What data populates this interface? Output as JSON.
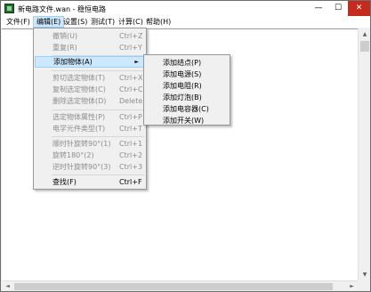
{
  "window": {
    "title": "新电路文件.wan - 稳恒电路",
    "minimize_glyph": "—",
    "maximize_glyph": "☐",
    "close_glyph": "✕",
    "close_color": "#c42b1c",
    "icon": "circuit-app-icon"
  },
  "menubar": {
    "file": "文件(F)",
    "edit": "编辑(E)",
    "settings": "设置(S)",
    "test": "测试(T)",
    "compute": "计算(C)",
    "help": "帮助(H)"
  },
  "edit_menu": {
    "undo": {
      "label": "撤销(U)",
      "shortcut": "Ctrl+Z"
    },
    "redo": {
      "label": "重复(R)",
      "shortcut": "Ctrl+Y"
    },
    "add_object": {
      "label": "添加物体(A)",
      "arrow": "►"
    },
    "cut": {
      "label": "剪切选定物体(T)",
      "shortcut": "Ctrl+X"
    },
    "copy": {
      "label": "复制选定物体(C)",
      "shortcut": "Ctrl+C"
    },
    "delete": {
      "label": "删除选定物体(D)",
      "shortcut": "Delete"
    },
    "properties": {
      "label": "选定物体属性(P)",
      "shortcut": "Ctrl+P"
    },
    "element_type": {
      "label": "电学元件类型(T)",
      "shortcut": "Ctrl+T"
    },
    "rotate_ccw90": {
      "label": "顺时针旋转90°(1)",
      "shortcut": "Ctrl+1"
    },
    "rotate180": {
      "label": "旋转180°(2)",
      "shortcut": "Ctrl+2"
    },
    "rotate_cw90": {
      "label": "逆时针旋转90°(3)",
      "shortcut": "Ctrl+3"
    },
    "find": {
      "label": "查找(F)",
      "shortcut": "Ctrl+F"
    }
  },
  "add_submenu": {
    "node": "添加结点(P)",
    "source": "添加电源(S)",
    "resistor": "添加电阻(R)",
    "bulb": "添加灯泡(B)",
    "capacitor": "添加电容器(C)",
    "switch": "添加开关(W)"
  },
  "colors": {
    "highlight": "#cce8ff",
    "highlight_border": "#99d1ff",
    "disabled_text": "#8d8d8d"
  }
}
